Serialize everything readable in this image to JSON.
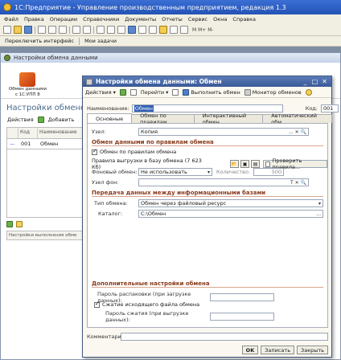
{
  "app": {
    "title": "1С:Предприятие - Управление производственным предприятием, редакция 1.3"
  },
  "menu": [
    "Файл",
    "Правка",
    "Операции",
    "Справочники",
    "Документы",
    "Отчеты",
    "Сервис",
    "Окна",
    "Справка"
  ],
  "toolbar2": {
    "switch_interface": "Переключить интерфейс",
    "my_tasks": "Мои задачи"
  },
  "bgwin": {
    "title": "Настройки обмена данными",
    "icons": [
      {
        "label": "Обмен данными с 1С:УПП 8"
      },
      {
        "label": ""
      },
      {
        "label": ""
      },
      {
        "label": ""
      },
      {
        "label": ""
      }
    ],
    "heading": "Настройки обменов",
    "actions_label": "Действия",
    "add_label": "Добавить",
    "grid": {
      "col_code": "Код",
      "col_name": "Наименование",
      "row_code": "001",
      "row_name": "Обмен"
    },
    "bottom_panel": "Настройки выполнения обме"
  },
  "dialog": {
    "title": "Настройки обмена данными: Обмен",
    "toolbar": {
      "actions": "Действия",
      "goto": "Перейти",
      "run": "Выполнить обмен",
      "monitor": "Монитор обменов"
    },
    "name_label": "Наименование:",
    "name_value": "Обмен",
    "code_label": "Код:",
    "code_value": "001",
    "tabs": [
      "Основные",
      "Обмен по правилам",
      "Интерактивный обмен",
      "Автоматический обм..."
    ],
    "node_label": "Узел:",
    "node_value": "Копия",
    "section1": "Обмен данными по правилам обмена",
    "rules_check": "Обмен по правилам обмена",
    "rules_upload_label": "Правила выгрузки в базу обмена (7 623 Кб)",
    "check_rules_btn": "Проверить правила...",
    "bg_exchange_label": "Фоновый обмен:",
    "bg_exchange_value": "Не использовать",
    "qty_label": "Количество:",
    "qty_value": "500",
    "node_bg_label": "Узел фон:",
    "node_bg_value": "",
    "section2": "Передача данных между информационными базами",
    "exchange_type_label": "Тип обмена:",
    "exchange_type_value": "Обмен через файловый ресурс",
    "catalog_label": "Каталог:",
    "catalog_value": "C:\\Обмен",
    "section3": "Дополнительные настройки обмена",
    "unpack_pass_label": "Пароль распаковки (при загрузке данных):",
    "compress_check": "Сжатие исходящего файла обмена",
    "compress_pass_label": "Пароль сжатия (при выгрузке данных):",
    "comment_label": "Комментарий:",
    "comment_value": "",
    "footer": {
      "ok": "OK",
      "save": "Записать",
      "close": "Закрыть"
    }
  }
}
